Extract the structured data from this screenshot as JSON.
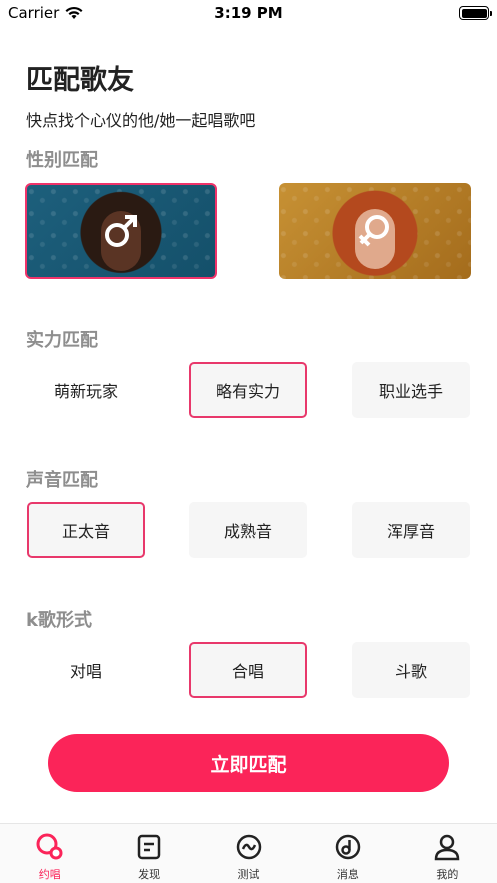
{
  "status_bar": {
    "carrier": "Carrier",
    "time": "3:19 PM"
  },
  "header": {
    "title": "匹配歌友",
    "subtitle": "快点找个心仪的他/她一起唱歌吧"
  },
  "gender": {
    "label": "性别匹配",
    "options": [
      {
        "icon": "male-symbol-icon",
        "selected": true
      },
      {
        "icon": "female-symbol-icon",
        "selected": false
      }
    ]
  },
  "skill": {
    "label": "实力匹配",
    "options": [
      "萌新玩家",
      "略有实力",
      "职业选手"
    ],
    "selected": "略有实力"
  },
  "voice": {
    "label": "声音匹配",
    "options": [
      "正太音",
      "成熟音",
      "浑厚音"
    ],
    "selected": "正太音"
  },
  "ktv": {
    "label": "k歌形式",
    "options": [
      "对唱",
      "合唱",
      "斗歌"
    ],
    "selected": "合唱"
  },
  "match_button": {
    "label": "立即匹配"
  },
  "tab_bar": {
    "items": [
      {
        "label": "约唱",
        "icon": "sing-icon",
        "active": true
      },
      {
        "label": "发现",
        "icon": "discover-icon",
        "active": false
      },
      {
        "label": "测试",
        "icon": "test-icon",
        "active": false
      },
      {
        "label": "消息",
        "icon": "message-icon",
        "active": false
      },
      {
        "label": "我的",
        "icon": "profile-icon",
        "active": false
      }
    ]
  },
  "colors": {
    "accent": "#fb2459",
    "selected_border": "#e8386b",
    "section_title": "#8e8e8e"
  }
}
